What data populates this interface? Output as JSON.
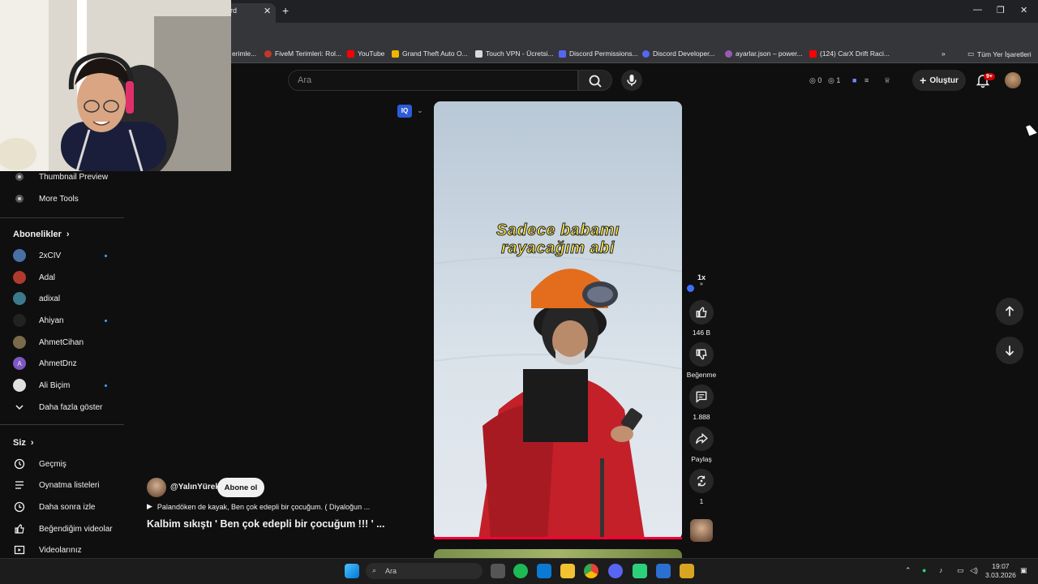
{
  "browser": {
    "active_tab_title": "rd",
    "bookmarks": [
      {
        "label": "erimle...",
        "color": "#888888"
      },
      {
        "label": "FiveM Terimleri: Rol...",
        "color": "#c0392b"
      },
      {
        "label": "YouTube",
        "color": "#ff0000"
      },
      {
        "label": "Grand Theft Auto O...",
        "color": "#f0b400"
      },
      {
        "label": "Touch VPN - Ücretsi...",
        "color": "#d9d9d9"
      },
      {
        "label": "Discord Permissions...",
        "color": "#5865f2"
      },
      {
        "label": "Discord Developer...",
        "color": "#5865f2"
      },
      {
        "label": "ayarlar.json – power...",
        "color": "#9b59b6"
      },
      {
        "label": "(124) CarX Drift Raci...",
        "color": "#ff0000"
      }
    ],
    "all_bookmarks_label": "Tüm Yer İşaretleri"
  },
  "header": {
    "search_placeholder": "Ara",
    "stat_views": "0",
    "stat_eye": "1",
    "create_label": "Oluştur",
    "notif_badge": "9+"
  },
  "sidebar": {
    "tools": [
      {
        "label": "Thumbnail Preview",
        "icon": "settings-icon"
      },
      {
        "label": "More Tools",
        "icon": "settings-icon"
      }
    ],
    "subscriptions_title": "Abonelikler",
    "subscriptions": [
      {
        "label": "2xCIV",
        "avatar_color": "#4a6fa5",
        "new": true
      },
      {
        "label": "Adal",
        "avatar_color": "#b03a2e",
        "new": false
      },
      {
        "label": "adixal",
        "avatar_color": "#3b7a8c",
        "new": false
      },
      {
        "label": "Ahiyan",
        "avatar_color": "#222222",
        "new": true
      },
      {
        "label": "AhmetCihan",
        "avatar_color": "#7a6a4a",
        "new": false
      },
      {
        "label": "AhmetDnz",
        "avatar_color": "#7e57c2",
        "avatar_letter": "A",
        "new": false
      },
      {
        "label": "Ali Biçim",
        "avatar_color": "#e0e0e0",
        "new": true
      }
    ],
    "show_more_label": "Daha fazla göster",
    "you_title": "Siz",
    "you_items": [
      {
        "label": "Geçmiş",
        "icon": "history-icon"
      },
      {
        "label": "Oynatma listeleri",
        "icon": "playlist-icon"
      },
      {
        "label": "Daha sonra izle",
        "icon": "clock-icon"
      },
      {
        "label": "Beğendiğim videolar",
        "icon": "thumbs-up-icon"
      },
      {
        "label": "Videolarınız",
        "icon": "your-videos-icon"
      }
    ]
  },
  "short": {
    "caption_line1": "Sadece babamı",
    "caption_line2": "rayacağım abi",
    "speed_label": "1x",
    "like_count": "146 B",
    "dislike_label": "Beğenme",
    "comment_count": "1.888",
    "share_label": "Paylaş",
    "remix_count": "1",
    "channel_handle": "@YalınYürek",
    "subscribe_label": "Abone ol",
    "music_text": "Palandöken de kayak, Ben çok edepli bir çocuğum. ( Diyaloğun ...",
    "title": "Kalbim sıkıştı ' Ben çok edepli bir çocuğum !!! ' ..."
  },
  "taskbar": {
    "search_placeholder": "Ara",
    "time": "19:07",
    "date": "3.03.2026"
  }
}
